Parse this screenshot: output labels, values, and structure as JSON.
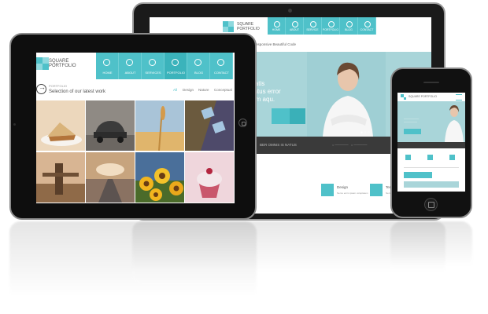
{
  "brand": {
    "name_line1": "SQUARE",
    "name_line2": "PORTFOLIO",
    "accent": "#4fc1c9",
    "accent_dark": "#3bb3bb",
    "dark_band": "#3a3a3a"
  },
  "tablet": {
    "nav": [
      {
        "label": "HOME",
        "icon": "home-icon"
      },
      {
        "label": "ABOUT",
        "icon": "user-icon"
      },
      {
        "label": "SERVICES",
        "icon": "grid-icon"
      },
      {
        "label": "PORTFOLIO",
        "icon": "image-icon"
      },
      {
        "label": "BLOG",
        "icon": "pencil-icon"
      },
      {
        "label": "CONTACT",
        "icon": "mail-icon"
      }
    ],
    "intro_small": "PORTFOLIO",
    "intro_big": "Selection of our latest work",
    "filters": [
      "All",
      "Design",
      "Nature",
      "Conceptual"
    ],
    "active_filter": "All"
  },
  "laptop": {
    "nav": [
      "HOME",
      "ABOUT",
      "SERVICE",
      "PORTFOLIO",
      "BLOG",
      "CONTACT"
    ],
    "crumb": "u Responsive Beautiful Code",
    "hero_text_1": "ciatis",
    "hero_text_2": "natus error",
    "hero_text_3": "tam aqu.",
    "band_text": "BER OMNIS IS NATUS",
    "features": [
      {
        "title": "Design",
        "text": "Nemo enim ipsam voluptatem"
      },
      {
        "title": "Templates",
        "text": "Nemo enim ipsam voluptatem"
      }
    ]
  },
  "phone": {
    "bar_text": "SQUARE PORTFOLIO"
  }
}
